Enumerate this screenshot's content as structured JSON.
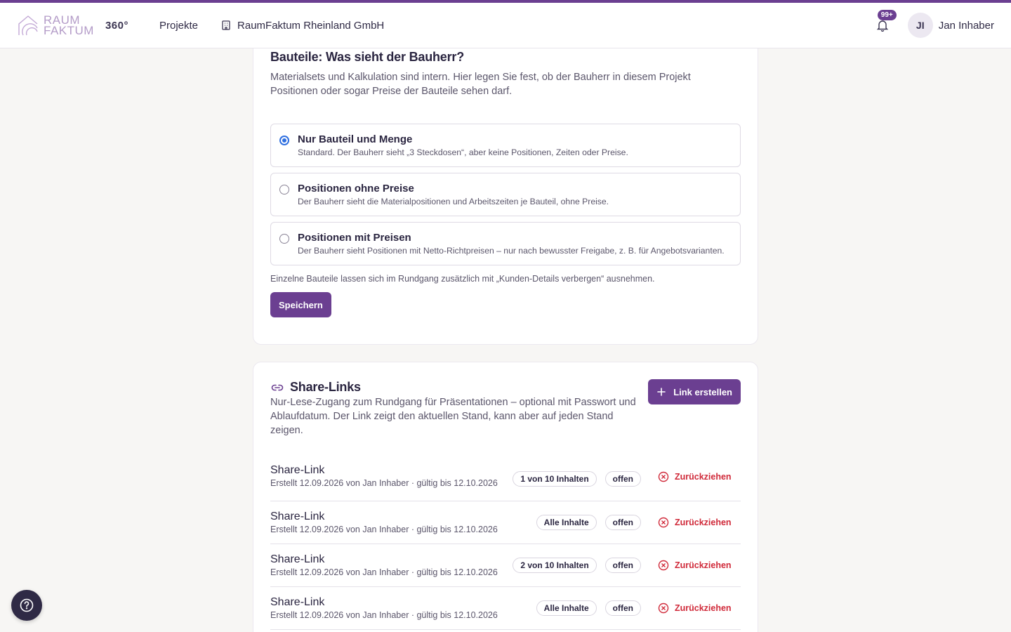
{
  "header": {
    "logo_line1": "RAUM",
    "logo_line2": "FAKTUM",
    "brand_suffix": "360°",
    "nav_projects": "Projekte",
    "company": "RaumFaktum Rheinland GmbH",
    "notifications_badge": "99+",
    "user_initials": "JI",
    "user_name": "Jan Inhaber"
  },
  "visibility": {
    "title": "Bauteile: Was sieht der Bauherr?",
    "description": "Materialsets und Kalkulation sind intern. Hier legen Sie fest, ob der Bauherr in diesem Projekt Positionen oder sogar Preise der Bauteile sehen darf.",
    "options": [
      {
        "title": "Nur Bauteil und Menge",
        "subtitle": "Standard. Der Bauherr sieht „3 Steckdosen“, aber keine Positionen, Zeiten oder Preise.",
        "selected": true
      },
      {
        "title": "Positionen ohne Preise",
        "subtitle": "Der Bauherr sieht die Materialpositionen und Arbeitszeiten je Bauteil, ohne Preise.",
        "selected": false
      },
      {
        "title": "Positionen mit Preisen",
        "subtitle": "Der Bauherr sieht Positionen mit Netto-Richtpreisen – nur nach bewusster Freigabe, z. B. für Angebotsvarianten.",
        "selected": false
      }
    ],
    "hint": "Einzelne Bauteile lassen sich im Rundgang zusätzlich mit „Kunden-Details verbergen“ ausnehmen.",
    "save_label": "Speichern"
  },
  "share": {
    "title": "Share-Links",
    "description": "Nur-Lese-Zugang zum Rundgang für Präsentationen – optional mit Passwort und Ablaufdatum. Der Link zeigt den aktuellen Stand, kann aber auf jeden Stand zeigen.",
    "create_label": "Link erstellen",
    "links": [
      {
        "title": "Share-Link",
        "meta": "Erstellt 12.09.2026 von Jan Inhaber · gültig bis 12.10.2026",
        "scope": "1 von 10 Inhalten",
        "status": "offen",
        "revoke_label": "Zurückziehen"
      },
      {
        "title": "Share-Link",
        "meta": "Erstellt 12.09.2026 von Jan Inhaber · gültig bis 12.10.2026",
        "scope": "Alle Inhalte",
        "status": "offen",
        "revoke_label": "Zurückziehen"
      },
      {
        "title": "Share-Link",
        "meta": "Erstellt 12.09.2026 von Jan Inhaber · gültig bis 12.10.2026",
        "scope": "2 von 10 Inhalten",
        "status": "offen",
        "revoke_label": "Zurückziehen"
      },
      {
        "title": "Share-Link",
        "meta": "Erstellt 12.09.2026 von Jan Inhaber · gültig bis 12.10.2026",
        "scope": "Alle Inhalte",
        "status": "offen",
        "revoke_label": "Zurückziehen"
      }
    ]
  },
  "colors": {
    "accent": "#6b3f91",
    "danger": "#d02a3a",
    "radio_selected": "#2f6fe0"
  }
}
